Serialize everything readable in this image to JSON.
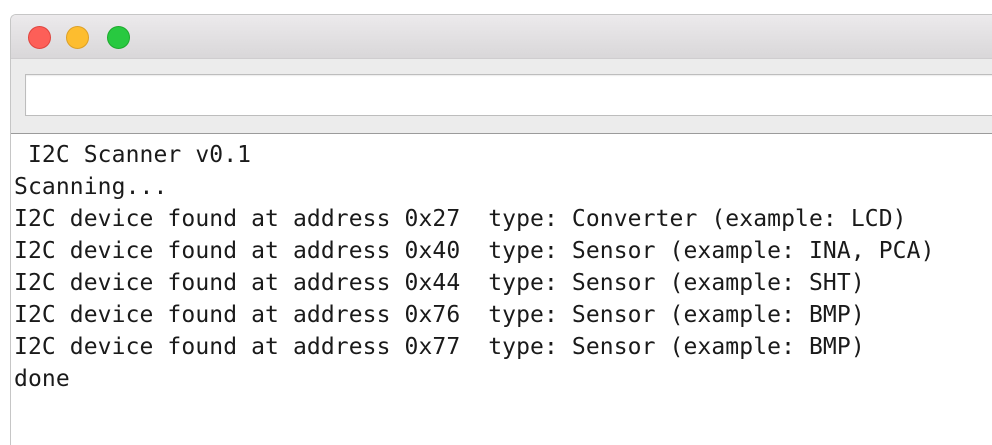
{
  "serial_monitor": {
    "send_input": {
      "value": "",
      "placeholder": ""
    },
    "output_lines": [
      " I2C Scanner v0.1",
      "Scanning...",
      "I2C device found at address 0x27  type: Converter (example: LCD)",
      "I2C device found at address 0x40  type: Sensor (example: INA, PCA)",
      "I2C device found at address 0x44  type: Sensor (example: SHT)",
      "I2C device found at address 0x76  type: Sensor (example: BMP)",
      "I2C device found at address 0x77  type: Sensor (example: BMP)",
      "done"
    ]
  },
  "colors": {
    "close": "#fd5f58",
    "minimize": "#fdbd2f",
    "zoom": "#28c940",
    "text": "#1a1a1a"
  },
  "icons": [
    "close-button",
    "minimize-button",
    "zoom-button"
  ]
}
